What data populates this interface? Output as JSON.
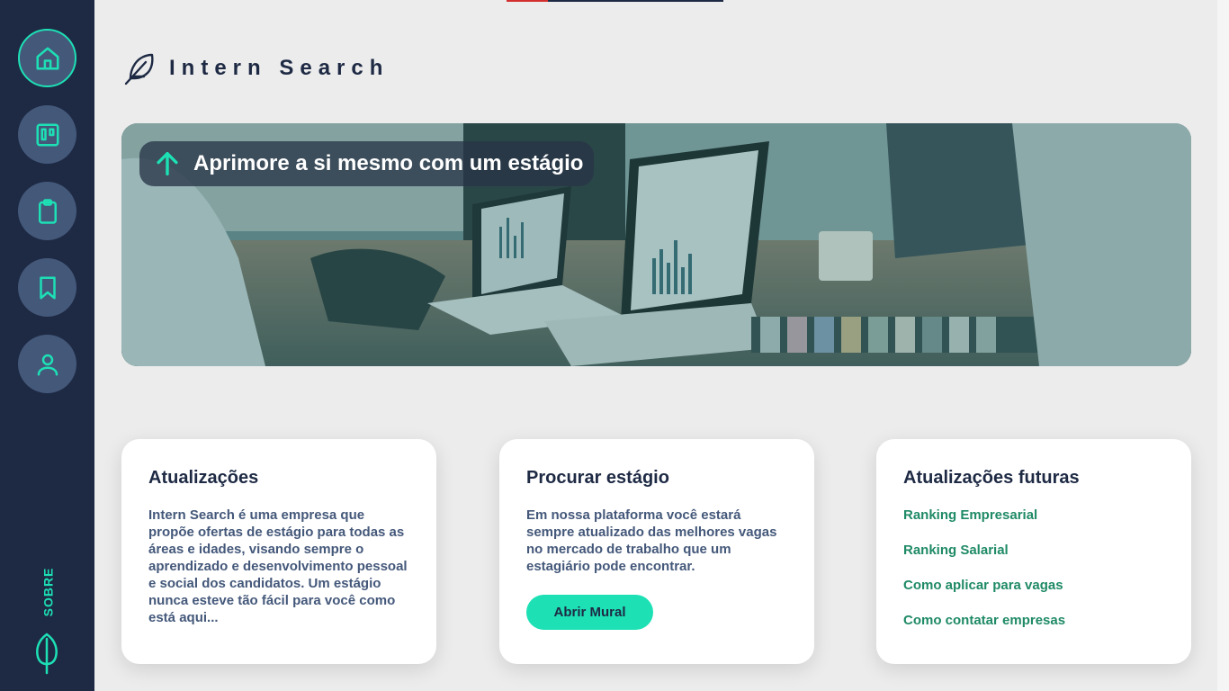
{
  "brand": {
    "title": "Intern Search"
  },
  "sidebar": {
    "items": [
      {
        "name": "home",
        "icon": "home-icon",
        "active": true
      },
      {
        "name": "board",
        "icon": "board-icon"
      },
      {
        "name": "clipboard",
        "icon": "clipboard-icon"
      },
      {
        "name": "bookmark",
        "icon": "bookmark-icon"
      },
      {
        "name": "profile",
        "icon": "user-icon"
      }
    ],
    "about_label": "SOBRE"
  },
  "hero": {
    "headline": "Aprimore a si mesmo com um estágio"
  },
  "cards": {
    "updates": {
      "title": "Atualizações",
      "body": "Intern Search é uma empresa que propõe ofertas de estágio para todas as áreas e idades, visando sempre o aprendizado e desenvolvimento pessoal e social dos candidatos. Um estágio nunca esteve tão fácil para você como está aqui..."
    },
    "search": {
      "title": "Procurar estágio",
      "body": "Em nossa plataforma você estará sempre atualizado das melhores vagas no mercado de trabalho que um estagiário pode encontrar.",
      "button": "Abrir Mural"
    },
    "future": {
      "title": "Atualizações futuras",
      "links": [
        "Ranking Empresarial",
        "Ranking Salarial",
        "Como aplicar para vagas",
        "Como contatar empresas"
      ]
    }
  },
  "colors": {
    "sidebar": "#1e2a44",
    "accent": "#1de0b5",
    "link": "#1f8a66",
    "text": "#44587a"
  }
}
